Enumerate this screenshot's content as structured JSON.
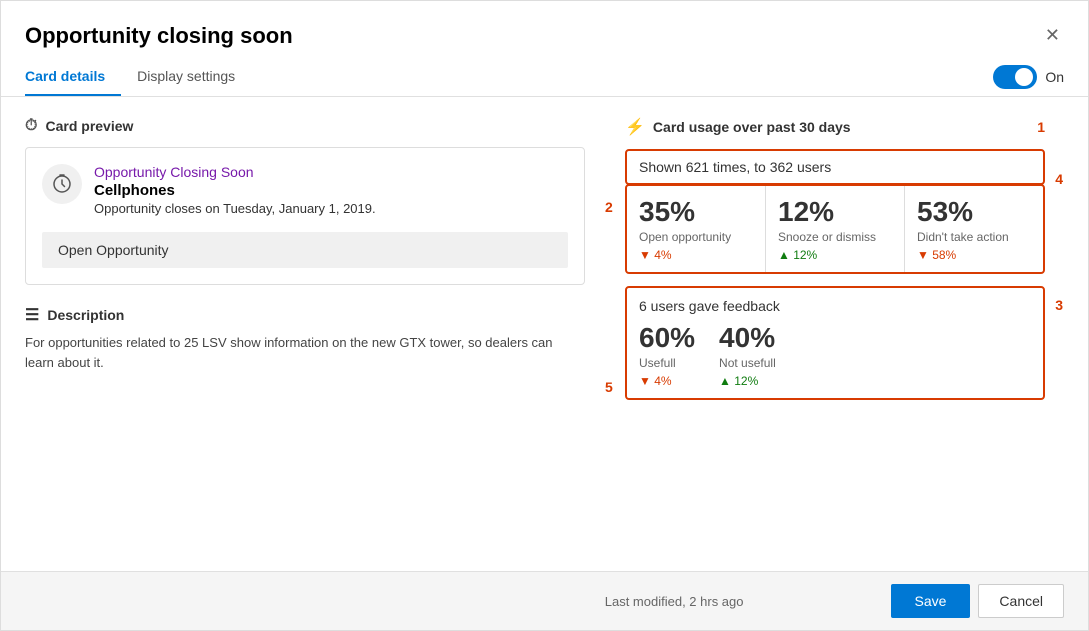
{
  "dialog": {
    "title": "Opportunity closing soon",
    "close_label": "✕"
  },
  "tabs": {
    "card_details": "Card details",
    "display_settings": "Display settings",
    "toggle_state": "On"
  },
  "card_preview": {
    "section_label": "Card preview",
    "subtitle_link": "Opportunity Closing Soon",
    "title": "Cellphones",
    "description": "Opportunity closes on Tuesday, January 1, 2019.",
    "action_button": "Open Opportunity"
  },
  "description_section": {
    "label": "Description",
    "text": "For opportunities related to 25 LSV show information on the new GTX tower, so dealers can learn about it."
  },
  "usage": {
    "section_label": "Card usage over past 30 days",
    "annotation_1": "1",
    "shown_text": "Shown 621 times, to 362 users",
    "annotation_2": "2",
    "annotation_3": "3",
    "annotation_4": "4",
    "annotation_5": "5",
    "metrics": [
      {
        "pct": "35%",
        "label": "Open opportunity",
        "change_direction": "down",
        "change_text": "▼ 4%"
      },
      {
        "pct": "12%",
        "label": "Snooze or dismiss",
        "change_direction": "up",
        "change_text": "▲ 12%"
      },
      {
        "pct": "53%",
        "label": "Didn't take action",
        "change_direction": "down",
        "change_text": "▼ 58%"
      }
    ],
    "feedback": {
      "title": "6 users gave feedback",
      "metrics": [
        {
          "pct": "60%",
          "label": "Usefull",
          "change_direction": "down",
          "change_text": "▼ 4%"
        },
        {
          "pct": "40%",
          "label": "Not usefull",
          "change_direction": "up",
          "change_text": "▲ 12%"
        }
      ]
    }
  },
  "footer": {
    "timestamp": "Last modified, 2 hrs ago",
    "save_label": "Save",
    "cancel_label": "Cancel"
  }
}
